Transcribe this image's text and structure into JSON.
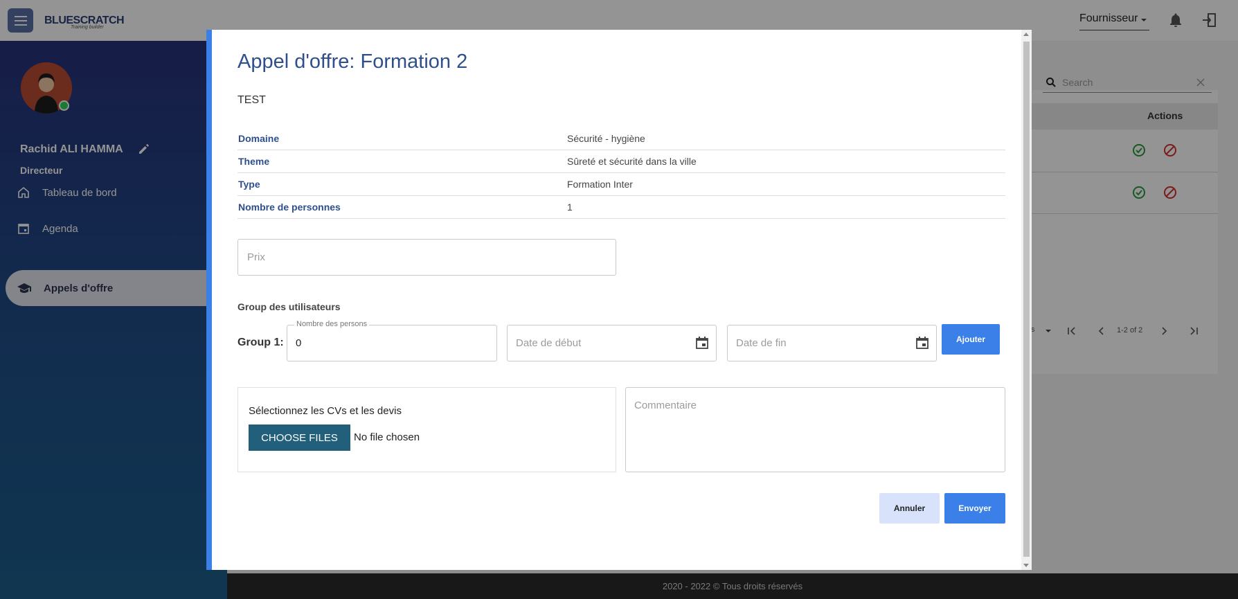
{
  "app": {
    "logo": "BLUESCRATCH",
    "logo_sub": "Training builder"
  },
  "header": {
    "role": "Fournisseur"
  },
  "user": {
    "name": "Rachid ALI HAMMA",
    "role": "Directeur"
  },
  "sidebar": {
    "items": [
      {
        "label": "Tableau de bord",
        "icon": "home-icon",
        "active": false
      },
      {
        "label": "Agenda",
        "icon": "calendar-icon",
        "active": false
      },
      {
        "label": "Appels d'offre",
        "icon": "school-icon",
        "active": true
      }
    ]
  },
  "main": {
    "search_placeholder": "Search",
    "actions_header": "Actions",
    "pager": {
      "per_page_suffix": "s",
      "range": "1-2 of 2"
    }
  },
  "footer": {
    "text": "2020 - 2022 © Tous droits réservés"
  },
  "modal": {
    "title": "Appel d'offre: Formation 2",
    "description": "TEST",
    "info": [
      {
        "key": "Domaine",
        "value": "Sécurité - hygiène"
      },
      {
        "key": "Theme",
        "value": "Sûreté et sécurité dans la ville"
      },
      {
        "key": "Type",
        "value": "Formation Inter"
      },
      {
        "key": "Nombre de personnes",
        "value": "1"
      }
    ],
    "prix_placeholder": "Prix",
    "group_title": "Group des utilisateurs",
    "group": {
      "label": "Group 1:",
      "persons_label": "Nombre des persons",
      "persons_value": "0",
      "date_debut_placeholder": "Date de début",
      "date_fin_placeholder": "Date de fin",
      "add_label": "Ajouter"
    },
    "files": {
      "label": "Sélectionnez les CVs et les devis",
      "button": "CHOOSE FILES",
      "status": "No file chosen"
    },
    "comment_placeholder": "Commentaire",
    "cancel_label": "Annuler",
    "send_label": "Envoyer"
  }
}
